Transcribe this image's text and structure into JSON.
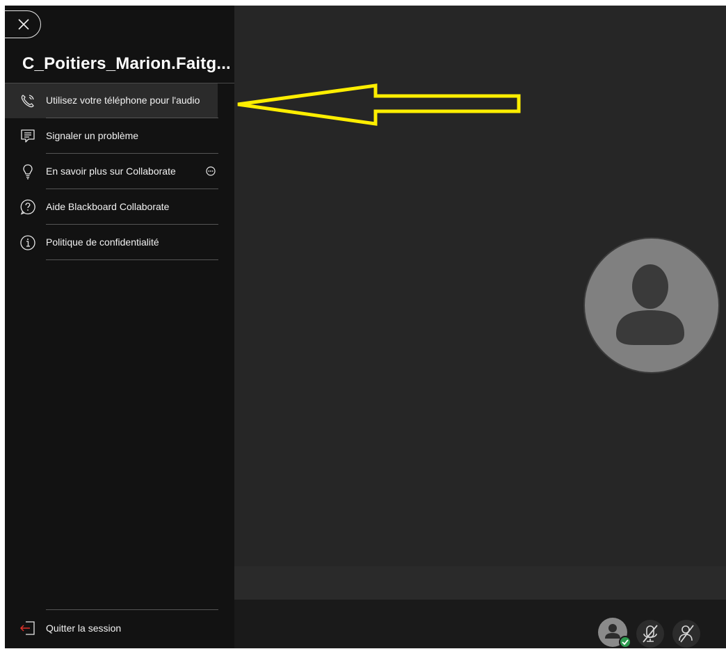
{
  "session": {
    "title": "C_Poitiers_Marion.Faitg..."
  },
  "menu": {
    "items": [
      {
        "label": "Utilisez votre téléphone pour l'audio",
        "icon": "phone-icon"
      },
      {
        "label": "Signaler un problème",
        "icon": "report-icon"
      },
      {
        "label": "En savoir plus sur Collaborate",
        "icon": "lightbulb-icon"
      },
      {
        "label": "Aide Blackboard Collaborate",
        "icon": "help-icon"
      },
      {
        "label": "Politique de confidentialité",
        "icon": "info-icon"
      }
    ],
    "quit_label": "Quitter la session"
  },
  "colors": {
    "sidebar_bg": "#121212",
    "main_bg": "#262626",
    "highlight_arrow": "#ffee00",
    "quit_icon": "#e0322a",
    "status_ok": "#2e9b4f"
  }
}
